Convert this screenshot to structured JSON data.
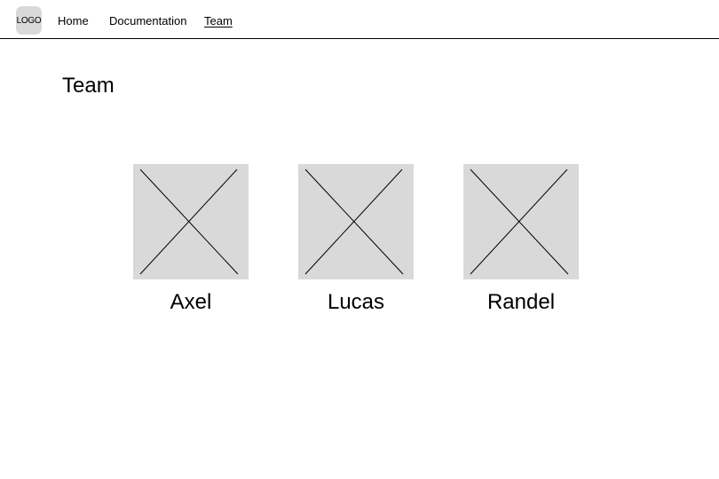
{
  "header": {
    "logo_text": "LOGO",
    "nav": {
      "home": "Home",
      "documentation": "Documentation",
      "team": "Team"
    }
  },
  "main": {
    "title": "Team",
    "members": [
      {
        "name": "Axel",
        "photo": "image-placeholder"
      },
      {
        "name": "Lucas",
        "photo": "image-placeholder"
      },
      {
        "name": "Randel",
        "photo": "image-placeholder"
      }
    ]
  },
  "colors": {
    "placeholder_fill": "#d9d9d9",
    "text": "#000000",
    "background": "#ffffff"
  }
}
